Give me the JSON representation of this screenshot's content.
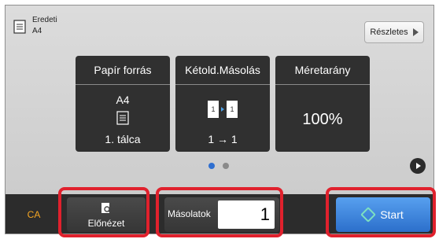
{
  "header": {
    "original_label": "Eredeti",
    "original_size": "A4",
    "details_label": "Részletes"
  },
  "tiles": [
    {
      "title": "Papír forrás",
      "value_top": "A4",
      "value_bottom": "1. tálca"
    },
    {
      "title": "Kétold.Másolás",
      "value_bottom": "1 → 1"
    },
    {
      "title": "Méretarány",
      "value_big": "100%"
    }
  ],
  "bottom_bar": {
    "ca_label": "CA",
    "preview_label": "Előnézet",
    "copies_label": "Másolatok",
    "copies_value": "1",
    "start_label": "Start"
  },
  "colors": {
    "accent": "#2c6fcb",
    "highlight": "#e0212d",
    "ca": "#f5a623"
  }
}
